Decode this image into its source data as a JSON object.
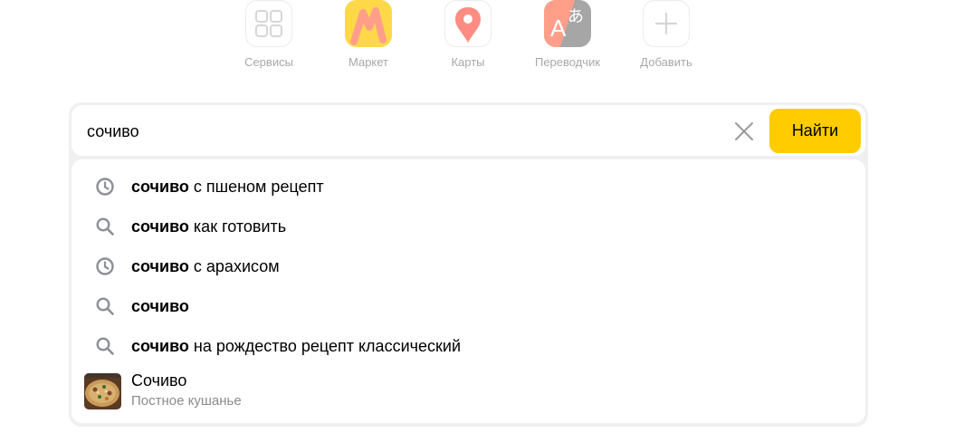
{
  "services": [
    {
      "label": "Сервисы",
      "icon": "grid-icon"
    },
    {
      "label": "Маркет",
      "icon": "market-logo-icon",
      "colors": [
        "#ffcc00",
        "#ff9f8a"
      ]
    },
    {
      "label": "Карты",
      "icon": "map-pin-icon",
      "colors": [
        "#ff8c82"
      ]
    },
    {
      "label": "Переводчик",
      "icon": "translate-icon",
      "glyph": "A",
      "glyph2": "あ",
      "colors": [
        "#ff9f8a",
        "#a6a6a6"
      ]
    },
    {
      "label": "Добавить",
      "icon": "plus-icon"
    }
  ],
  "search": {
    "value": "сочиво",
    "button_label": "Найти",
    "button_color": "#ffcc00"
  },
  "suggestions": [
    {
      "type": "history",
      "icon": "clock-icon",
      "bold": "сочиво",
      "rest": " с пшеном рецепт"
    },
    {
      "type": "search",
      "icon": "search-icon",
      "bold": "сочиво",
      "rest": " как готовить"
    },
    {
      "type": "history",
      "icon": "clock-icon",
      "bold": "сочиво",
      "rest": " с арахисом"
    },
    {
      "type": "search",
      "icon": "search-icon",
      "bold": "сочиво",
      "rest": ""
    },
    {
      "type": "search",
      "icon": "search-icon",
      "bold": "сочиво",
      "rest": " на рождество рецепт классический"
    }
  ],
  "fact": {
    "title": "Сочиво",
    "subtitle": "Постное кушанье",
    "image": "dish-thumbnail"
  }
}
